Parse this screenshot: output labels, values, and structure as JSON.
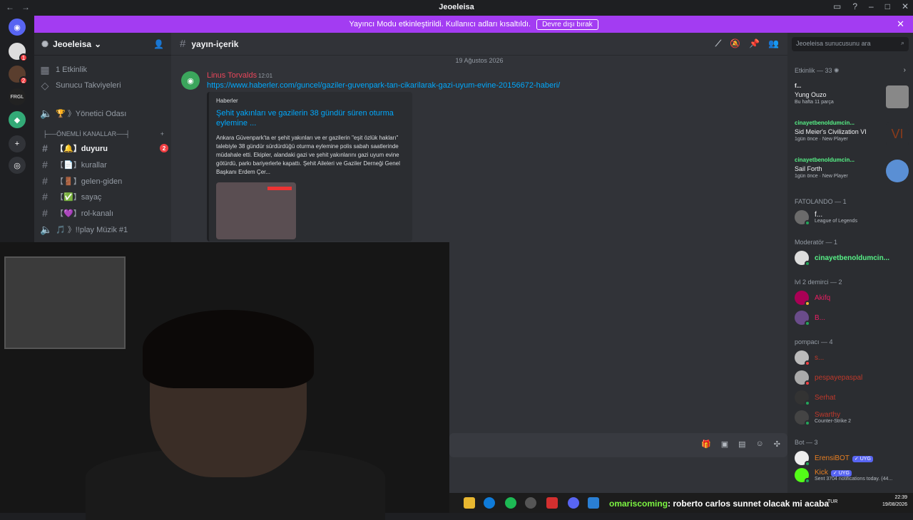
{
  "window": {
    "title": "Jeoeleisa",
    "back": "←",
    "forward": "→"
  },
  "banner": {
    "text": "Yayıncı Modu etkinleştirildi. Kullanıcı adları kısaltıldı.",
    "button": "Devre dışı bırak",
    "close": "✕"
  },
  "server": {
    "name": "Jeoeleisa"
  },
  "sidebar": {
    "items": [
      {
        "label": "1 Etkinlik"
      },
      {
        "label": "Sunucu Takviyeleri"
      },
      {
        "label": "🏆 》Yönetici Odası"
      }
    ],
    "category": "├──ÖNEMLİ KANALLAR──┤",
    "category_plus": "+",
    "channels": [
      {
        "label": "【🔔】duyuru",
        "badge": "2",
        "active": true
      },
      {
        "label": "【📄】kurallar"
      },
      {
        "label": "【🚪】gelen-giden"
      },
      {
        "label": "【✅】sayaç"
      },
      {
        "label": "【💜】rol-kanalı"
      },
      {
        "label": "🎵 》!!play Müzik #1"
      }
    ]
  },
  "channel": {
    "name": "yayın-içerik",
    "date_divider": "19 Ağustos 2026"
  },
  "message": {
    "author": "Linus Torvalds",
    "time": "12:01",
    "link": "https://www.haberler.com/guncel/gaziler-guvenpark-tan-cikarilarak-gazi-uyum-evine-20156672-haberi/",
    "embed": {
      "provider": "Haberler",
      "title": "Şehit yakınları ve gazilerin 38 gündür süren oturma eylemine ...",
      "description": "Ankara Güvenpark'ta er şehit yakınları ve er gazilerin \"eşit özlük hakları\" talebiyle 38 gündür sürdürdüğü oturma eylemine polis sabah saatlerinde müdahale etti. Ekipler, alandaki gazi ve şehit yakınlarını gazi uyum evine götürdü, parkı bariyerlerle kapattı. Şehit Aileleri ve Gaziler Derneği Genel Başkanı Erdem Çer..."
    }
  },
  "members": {
    "search_placeholder": "Jeoeleisa sunucusunu ara",
    "activity_header": "Etkinlik — 33",
    "activities": [
      {
        "pre": "f...",
        "name": "Yung Ouzo",
        "sub": "Bu hafta 11 parça"
      },
      {
        "pre": "cinayetbenoldumcin...",
        "name": "Sid Meier's Civilization VI",
        "sub": "1gün önce · New Player"
      },
      {
        "pre": "cinayetbenoldumcin...",
        "name": "Sail Forth",
        "sub": "1gün önce · New Player"
      }
    ],
    "groups": [
      {
        "header": "FATOLANDO — 1",
        "members": [
          {
            "name": "f...",
            "sub": "League of Legends",
            "color": "#f2f3f5"
          }
        ]
      },
      {
        "header": "Moderatör — 1",
        "members": [
          {
            "name": "cinayetbenoldumcin...",
            "color": "#57f287"
          }
        ]
      },
      {
        "header": "lvl 2 demirci — 2",
        "members": [
          {
            "name": "Akifq",
            "color": "#e91e63"
          },
          {
            "name": "B...",
            "color": "#e91e63"
          }
        ]
      },
      {
        "header": "pompacı — 4",
        "members": [
          {
            "name": "s...",
            "color": "#c0392b"
          },
          {
            "name": "pespayepaspal",
            "color": "#c0392b"
          },
          {
            "name": "Serhat",
            "color": "#c0392b"
          },
          {
            "name": "Swarthy",
            "sub": "Counter-Strike 2",
            "color": "#c0392b"
          }
        ]
      },
      {
        "header": "Bot — 3",
        "members": [
          {
            "name": "ErensiBOT",
            "tag": "✓ UYG",
            "color": "#e67e22"
          },
          {
            "name": "Kick",
            "tag": "✓ UYG",
            "sub": "Sent 3704 notifications today. (44...",
            "color": "#e67e22"
          }
        ]
      }
    ]
  },
  "ticker": {
    "user": "omariscoming",
    "text": ": roberto carlos sunnet olacak mi acaba"
  },
  "system": {
    "lang": "TUR",
    "time": "22:39",
    "date": "19/08/2026"
  }
}
